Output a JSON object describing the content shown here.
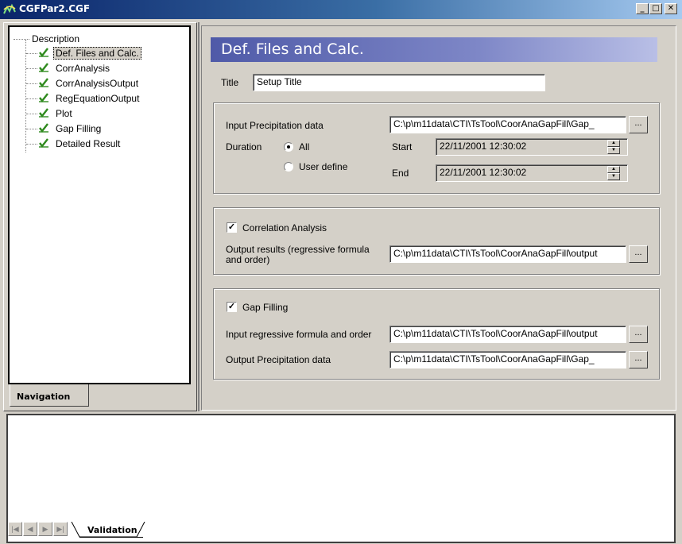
{
  "window": {
    "title": "CGFPar2.CGF",
    "controls": {
      "minimize": "_",
      "maximize": "□",
      "close": "✕"
    }
  },
  "navigation": {
    "tab_label": "Navigation",
    "tree": [
      {
        "label": "Description",
        "checked": false
      },
      {
        "label": "Def. Files and Calc.",
        "checked": true,
        "selected": true
      },
      {
        "label": "CorrAnalysis",
        "checked": true
      },
      {
        "label": "CorrAnalysisOutput",
        "checked": true
      },
      {
        "label": "RegEquationOutput",
        "checked": true
      },
      {
        "label": "Plot",
        "checked": true
      },
      {
        "label": "Gap Filling",
        "checked": true
      },
      {
        "label": "Detailed Result",
        "checked": true
      }
    ]
  },
  "main": {
    "header": "Def. Files and Calc.",
    "title_label": "Title",
    "title_value": "Setup Title",
    "input": {
      "precip_label": "Input Precipitation data",
      "precip_value": "C:\\p\\m11data\\CTI\\TsTool\\CoorAnaGapFill\\Gap_",
      "duration_label": "Duration",
      "radio_all": "All",
      "radio_user": "User define",
      "start_label": "Start",
      "start_value": "22/11/2001  12:30:02",
      "end_label": "End",
      "end_value": "22/11/2001  12:30:02"
    },
    "correlation": {
      "checkbox_label": "Correlation Analysis",
      "checked": true,
      "output_label_line1": "Output results (regressive formula",
      "output_label_line2": "and order)",
      "output_value": "C:\\p\\m11data\\CTI\\TsTool\\CoorAnaGapFill\\output"
    },
    "gapfill": {
      "checkbox_label": "Gap Filling",
      "checked": true,
      "regressive_label": "Input regressive formula and order",
      "regressive_value": "C:\\p\\m11data\\CTI\\TsTool\\CoorAnaGapFill\\output",
      "output_label": "Output Precipitation data",
      "output_value": "C:\\p\\m11data\\CTI\\TsTool\\CoorAnaGapFill\\Gap_"
    },
    "browse_label": "..."
  },
  "validation": {
    "tab_label": "Validation"
  },
  "colors": {
    "titlebar_start": "#0a246a",
    "header_bar": "#4f5aa8",
    "check_green": "#2f8a1e",
    "face": "#d4d0c8"
  }
}
